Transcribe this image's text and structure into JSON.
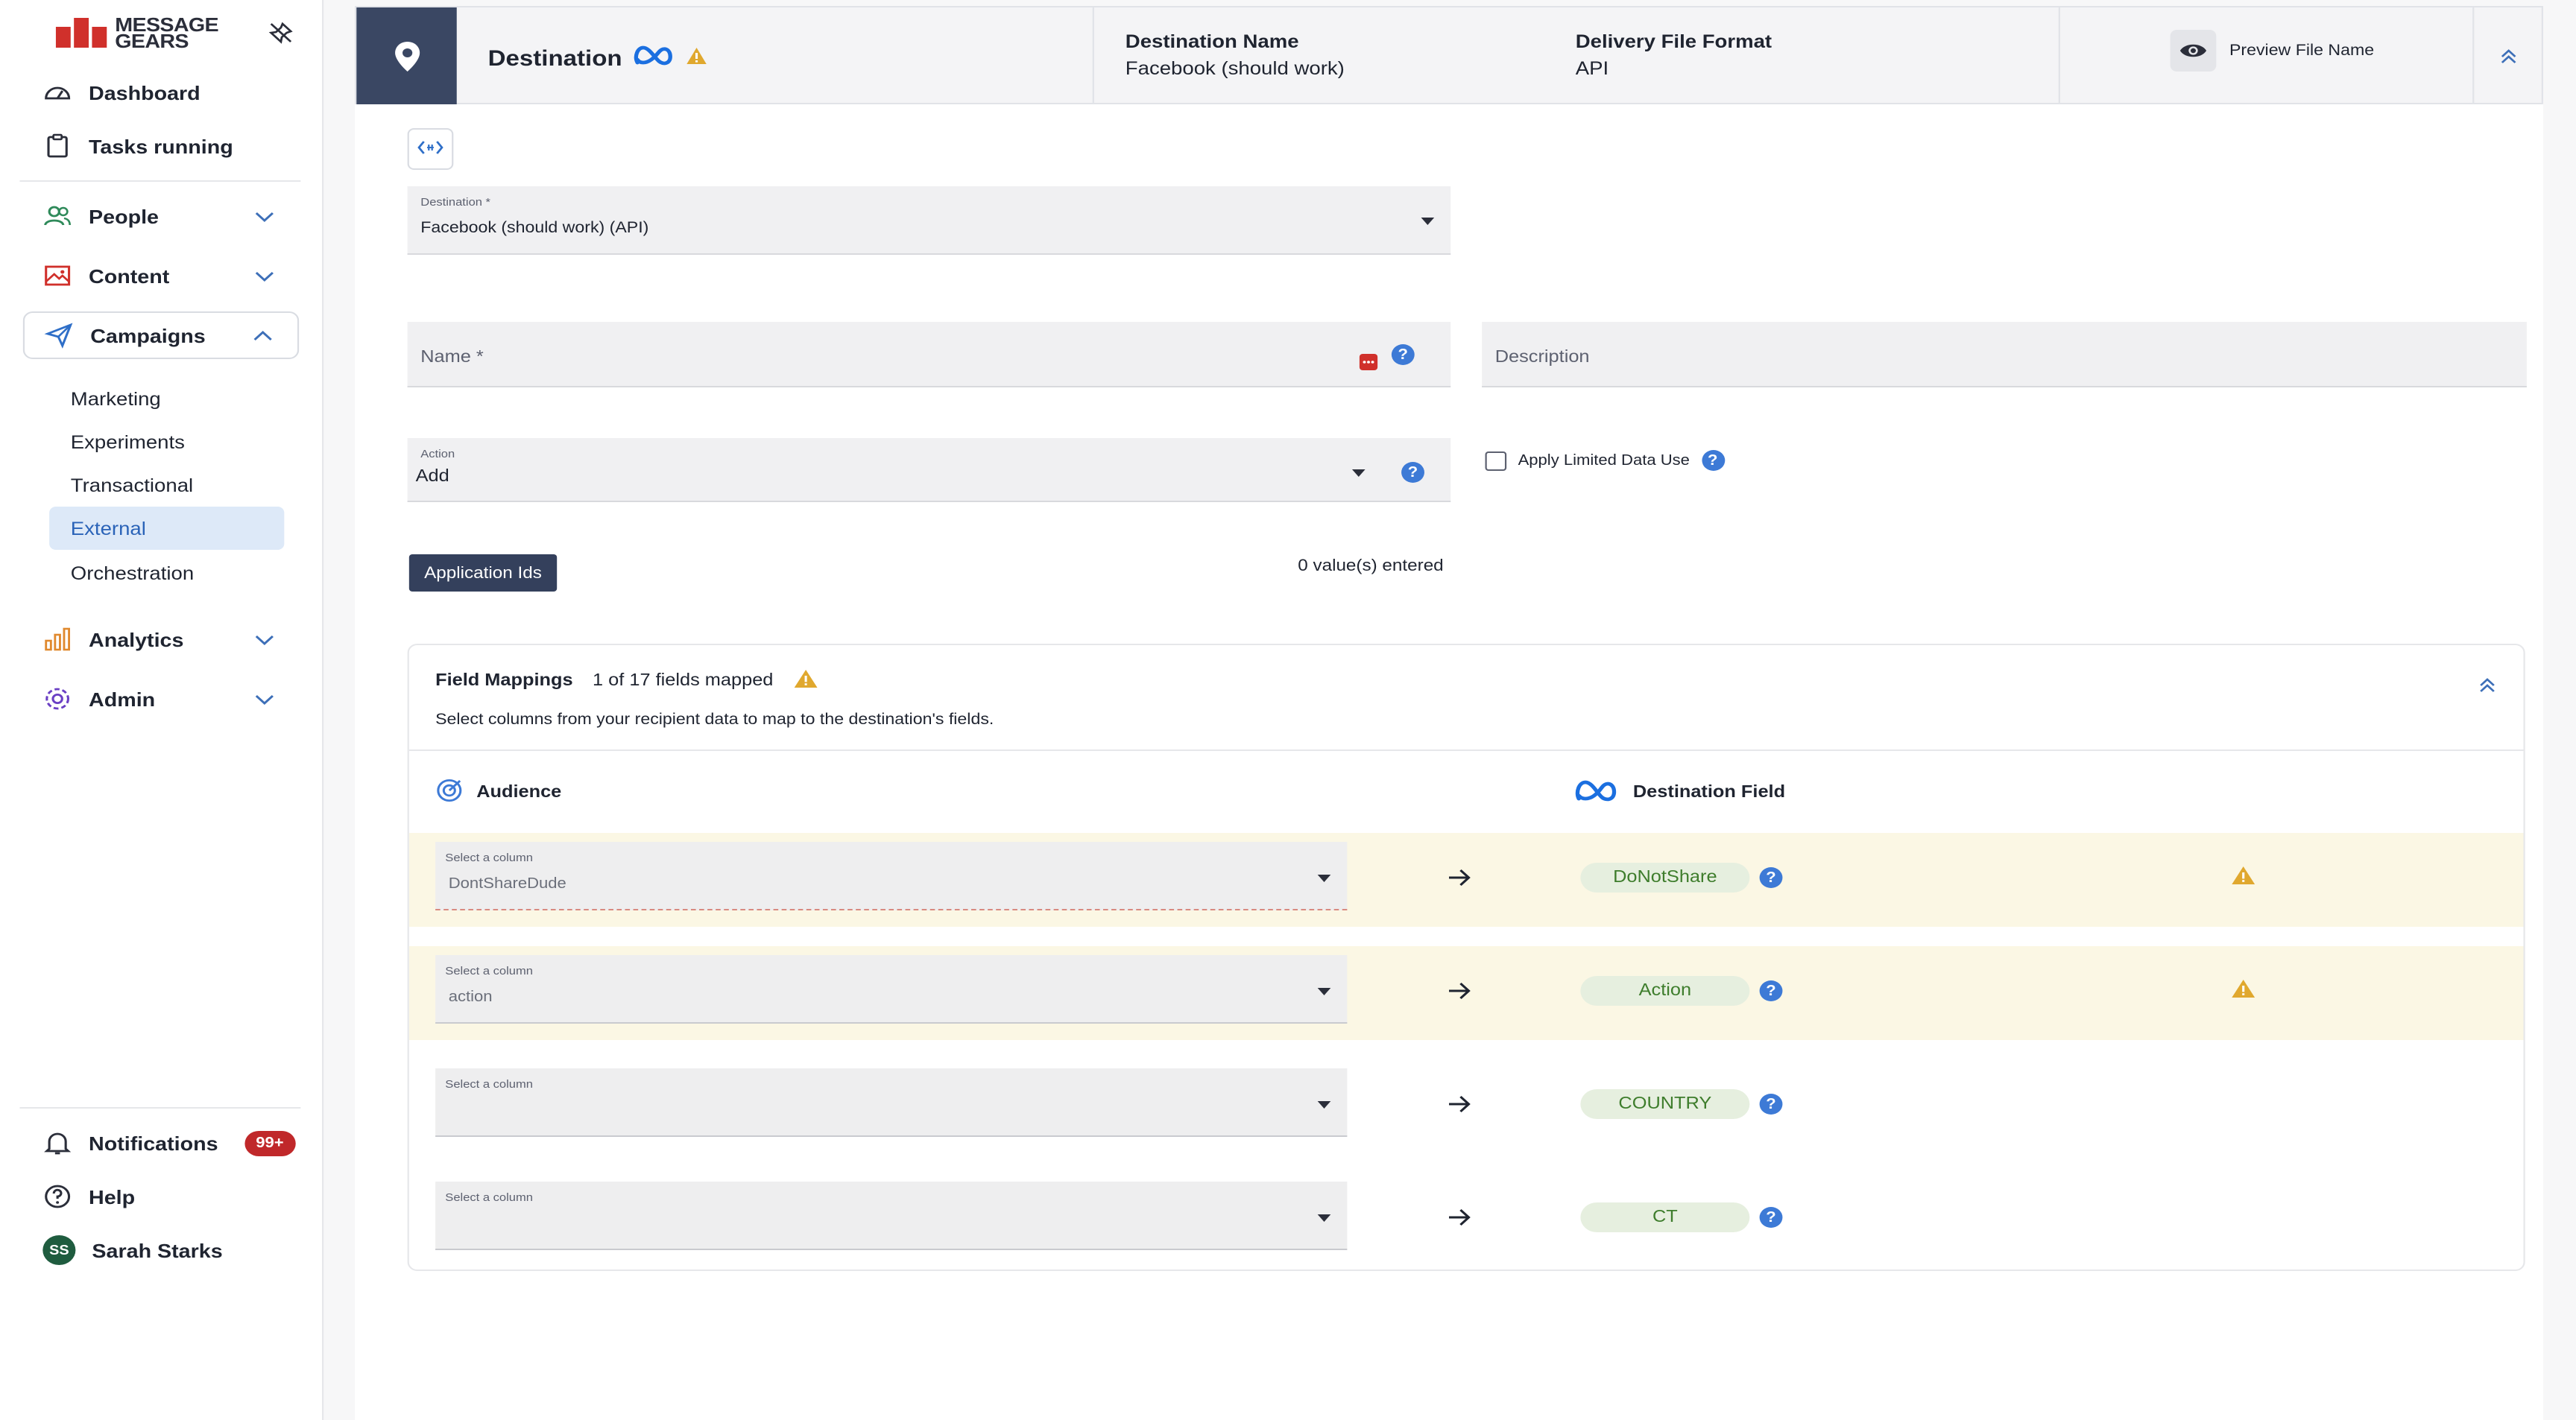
{
  "brand": {
    "line1": "MESSAGE",
    "line2": "GEARS"
  },
  "sidebar": {
    "dashboard": "Dashboard",
    "tasks": "Tasks running",
    "people": "People",
    "content": "Content",
    "campaigns": "Campaigns",
    "campaign_items": [
      "Marketing",
      "Experiments",
      "Transactional",
      "External",
      "Orchestration"
    ],
    "analytics": "Analytics",
    "admin": "Admin",
    "notifications": "Notifications",
    "notifications_badge": "99+",
    "help": "Help",
    "user_name": "Sarah Starks",
    "user_initials": "SS"
  },
  "header": {
    "title": "Destination",
    "dest_name_label": "Destination Name",
    "dest_name_value": "Facebook (should work)",
    "format_label": "Delivery File Format",
    "format_value": "API",
    "preview_label": "Preview File Name"
  },
  "form": {
    "destination_label": "Destination *",
    "destination_value": "Facebook (should work) (API)",
    "name_placeholder": "Name *",
    "description_placeholder": "Description",
    "action_label": "Action",
    "action_value": "Add",
    "limited_data_label": "Apply Limited Data Use",
    "application_ids_label": "Application Ids",
    "values_entered": "0 value(s) entered"
  },
  "mappings": {
    "title": "Field Mappings",
    "count_text": "1 of 17 fields mapped",
    "subtitle": "Select columns from your recipient data to map to the destination's fields.",
    "audience_header": "Audience",
    "destination_header": "Destination Field",
    "select_label": "Select a column",
    "rows": [
      {
        "value": "DontShareDude",
        "field": "DoNotShare",
        "warn": true
      },
      {
        "value": "action",
        "field": "Action",
        "warn": true
      },
      {
        "value": "",
        "field": "COUNTRY",
        "warn": false
      },
      {
        "value": "",
        "field": "CT",
        "warn": false
      }
    ]
  },
  "colors": {
    "brand_red": "#d0302b",
    "nav_active_bg": "#dde9f8",
    "header_dark": "#3a4763",
    "chip_bg": "#e6efdf",
    "chip_text": "#3e7d2c",
    "warn_row": "#fbf7e4",
    "warning": "#e0a82e",
    "help_blue": "#3d7ad6",
    "badge_red": "#c0282a"
  },
  "icons": [
    "pin-off-icon",
    "dashboard-icon",
    "clipboard-icon",
    "people-icon",
    "content-icon",
    "campaigns-icon",
    "analytics-icon",
    "admin-icon",
    "bell-icon",
    "help-circle-icon",
    "location-pin-icon",
    "meta-logo-icon",
    "warning-icon",
    "eye-icon",
    "chevron-up-icon",
    "code-icon",
    "target-icon",
    "arrow-right-icon"
  ]
}
